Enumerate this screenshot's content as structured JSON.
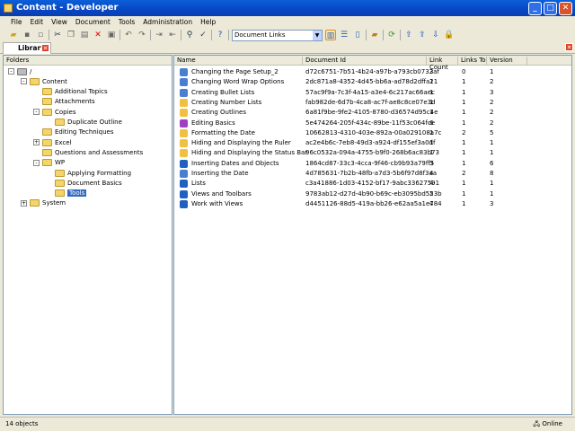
{
  "window": {
    "title": "Content - Developer"
  },
  "menu": [
    "File",
    "Edit",
    "View",
    "Document",
    "Tools",
    "Administration",
    "Help"
  ],
  "toolbar": {
    "view_select": "Document Links"
  },
  "tab": {
    "label": "Library"
  },
  "folders": {
    "header": "Folders",
    "nodes": [
      {
        "label": "/",
        "level": 0,
        "toggle": "-"
      },
      {
        "label": "Content",
        "level": 1,
        "toggle": "-"
      },
      {
        "label": "Additional Topics",
        "level": 2
      },
      {
        "label": "Attachments",
        "level": 2
      },
      {
        "label": "Copies",
        "level": 2,
        "toggle": "-"
      },
      {
        "label": "Duplicate Outline",
        "level": 3
      },
      {
        "label": "Editing Techniques",
        "level": 2
      },
      {
        "label": "Excel",
        "level": 2,
        "toggle": "+"
      },
      {
        "label": "Questions and Assessments",
        "level": 2
      },
      {
        "label": "WP",
        "level": 2,
        "toggle": "-"
      },
      {
        "label": "Applying Formatting",
        "level": 3
      },
      {
        "label": "Document Basics",
        "level": 3
      },
      {
        "label": "Tools",
        "level": 3,
        "selected": true
      },
      {
        "label": "System",
        "level": 1,
        "toggle": "+"
      }
    ]
  },
  "list": {
    "columns": [
      "Name",
      "Document Id",
      "Link Count",
      "Links To",
      "Version"
    ],
    "rows": [
      {
        "icon": "topic",
        "name": "Changing the Page Setup_2",
        "id": "d72c6751-7b51-4b24-a97b-a793cb0732af",
        "count": "3",
        "to": "0",
        "ver": "1"
      },
      {
        "icon": "topic",
        "name": "Changing Word Wrap Options",
        "id": "2dc871a8-4352-4d45-bb6a-ad78d2dffa21",
        "count": "1",
        "to": "1",
        "ver": "2"
      },
      {
        "icon": "topic",
        "name": "Creating Bullet Lists",
        "id": "57ac9f9a-7c3f-4a15-a3e4-6c217ac66aec",
        "count": "1",
        "to": "1",
        "ver": "3"
      },
      {
        "icon": "question",
        "name": "Creating Number Lists",
        "id": "fab982de-6d7b-4ca8-ac7f-ae8c8ce07e3d",
        "count": "1",
        "to": "1",
        "ver": "2"
      },
      {
        "icon": "question",
        "name": "Creating Outlines",
        "id": "6a81f9be-9fe2-4105-8780-d36574d95c4e",
        "count": "1",
        "to": "1",
        "ver": "2"
      },
      {
        "icon": "section",
        "name": "Editing Basics",
        "id": "5e474264-205f-434c-89be-11f53c064fce",
        "count": "6",
        "to": "1",
        "ver": "2"
      },
      {
        "icon": "question",
        "name": "Formatting the Date",
        "id": "10662813-4310-403e-892a-00a029108a7c",
        "count": "1",
        "to": "2",
        "ver": "5"
      },
      {
        "icon": "question",
        "name": "Hiding and Displaying the Ruler",
        "id": "ac2e4b6c-7eb8-49d3-a924-df155ef3a0df",
        "count": "1",
        "to": "1",
        "ver": "1"
      },
      {
        "icon": "question",
        "name": "Hiding and Displaying the Status Bar",
        "id": "96c0532a-094a-4755-b9f0-268b6ac83b73",
        "count": "1",
        "to": "1",
        "ver": "1"
      },
      {
        "icon": "book",
        "name": "Inserting Dates and Objects",
        "id": "1864cd87-33c3-4cca-9f46-cb9b93a79ff5",
        "count": "3",
        "to": "1",
        "ver": "6"
      },
      {
        "icon": "topic",
        "name": "Inserting the Date",
        "id": "4d785631-7b2b-48fb-a7d3-5b6f97d8f3aa",
        "count": "4",
        "to": "2",
        "ver": "8"
      },
      {
        "icon": "book",
        "name": "Lists",
        "id": "c3a41886-1d03-4152-bf17-9abc33627591",
        "count": "4",
        "to": "1",
        "ver": "1"
      },
      {
        "icon": "book",
        "name": "Views and Toolbars",
        "id": "9783ab12-d27d-4b90-b69c-eb3095bd553b",
        "count": "2",
        "to": "1",
        "ver": "1"
      },
      {
        "icon": "book",
        "name": "Work with Views",
        "id": "d4451126-88d5-419a-bb26-e62aa5a1e784",
        "count": "4",
        "to": "1",
        "ver": "3"
      }
    ]
  },
  "status": {
    "count": "14 objects",
    "connection": "Online"
  }
}
